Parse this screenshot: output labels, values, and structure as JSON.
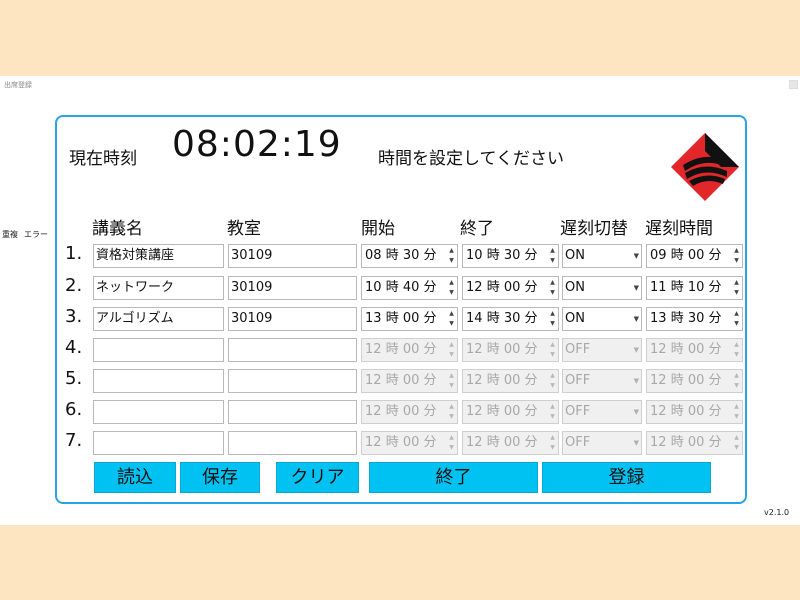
{
  "window": {
    "title": "出席登録",
    "version": "v2.1.0"
  },
  "side_labels": [
    "重複",
    "エラー"
  ],
  "header": {
    "now_label": "現在時刻",
    "clock": "08:02:19",
    "message": "時間を設定してください"
  },
  "colors": {
    "accent": "#00c2f2",
    "panel_border": "#2aa3e6",
    "background": "#fde5c2",
    "logo_red": "#e3262a"
  },
  "columns": [
    "講義名",
    "教室",
    "開始",
    "終了",
    "遅刻切替",
    "遅刻時間"
  ],
  "units": {
    "hour": "時",
    "minute": "分"
  },
  "rows": [
    {
      "num": "1.",
      "lecture": "資格対策講座",
      "room": "30109",
      "start_h": "08",
      "start_m": "30",
      "end_h": "10",
      "end_m": "30",
      "late": "ON",
      "late_h": "09",
      "late_m": "00"
    },
    {
      "num": "2.",
      "lecture": "ネットワーク",
      "room": "30109",
      "start_h": "10",
      "start_m": "40",
      "end_h": "12",
      "end_m": "00",
      "late": "ON",
      "late_h": "11",
      "late_m": "10"
    },
    {
      "num": "3.",
      "lecture": "アルゴリズム",
      "room": "30109",
      "start_h": "13",
      "start_m": "00",
      "end_h": "14",
      "end_m": "30",
      "late": "ON",
      "late_h": "13",
      "late_m": "30"
    },
    {
      "num": "4.",
      "lecture": "",
      "room": "",
      "start_h": "12",
      "start_m": "00",
      "end_h": "12",
      "end_m": "00",
      "late": "OFF",
      "late_h": "12",
      "late_m": "00"
    },
    {
      "num": "5.",
      "lecture": "",
      "room": "",
      "start_h": "12",
      "start_m": "00",
      "end_h": "12",
      "end_m": "00",
      "late": "OFF",
      "late_h": "12",
      "late_m": "00"
    },
    {
      "num": "6.",
      "lecture": "",
      "room": "",
      "start_h": "12",
      "start_m": "00",
      "end_h": "12",
      "end_m": "00",
      "late": "OFF",
      "late_h": "12",
      "late_m": "00"
    },
    {
      "num": "7.",
      "lecture": "",
      "room": "",
      "start_h": "12",
      "start_m": "00",
      "end_h": "12",
      "end_m": "00",
      "late": "OFF",
      "late_h": "12",
      "late_m": "00"
    }
  ],
  "buttons": {
    "load": "読込",
    "save": "保存",
    "clear": "クリア",
    "exit": "終了",
    "register": "登録"
  }
}
